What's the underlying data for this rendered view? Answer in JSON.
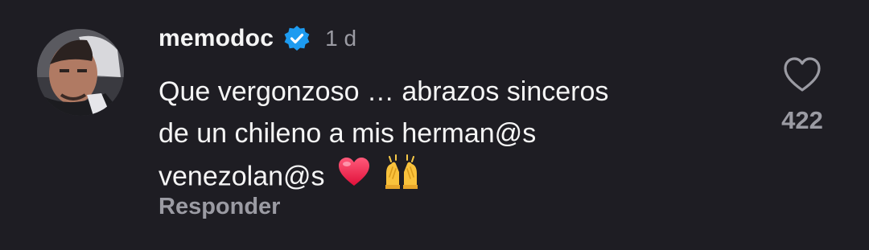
{
  "comment": {
    "username": "memodoc",
    "timestamp": "1 d",
    "lines": [
      "Que vergonzoso … abrazos sinceros",
      "de un chileno a mis herman@s",
      "venezolan@s"
    ],
    "emojis": [
      "heart-emoji",
      "raising-hands-emoji"
    ],
    "reply_label": "Responder",
    "like_count": "422"
  },
  "colors": {
    "background": "#1e1d23",
    "verified_badge": "#1d9bf0",
    "secondary_text": "#9b9ba3"
  }
}
